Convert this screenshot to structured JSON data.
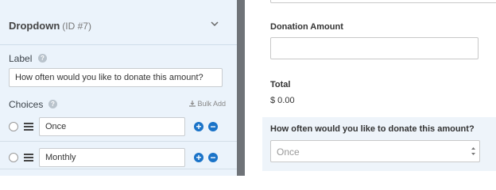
{
  "left_panel": {
    "header": {
      "title": "Dropdown",
      "id_text": "(ID #7)"
    },
    "label_section": {
      "label": "Label",
      "value": "How often would you like to donate this amount?"
    },
    "choices_section": {
      "label": "Choices",
      "bulk_add": "Bulk Add",
      "choices": [
        {
          "value": "Once"
        },
        {
          "value": "Monthly"
        }
      ]
    }
  },
  "preview": {
    "donation_label": "Donation Amount",
    "total_label": "Total",
    "total_value": "$ 0.00",
    "question_label": "How often would you like to donate this amount?",
    "select_value": "Once"
  },
  "colors": {
    "panel_bg": "#ebf3fb",
    "accent": "#1a73c8",
    "divider": "#6f7378",
    "highlight_bg": "#eef4fa"
  },
  "icons": [
    "chevron-down-icon",
    "help-icon",
    "download-icon",
    "drag-handle-icon",
    "plus-circle-icon",
    "minus-circle-icon",
    "select-arrows-icon"
  ]
}
